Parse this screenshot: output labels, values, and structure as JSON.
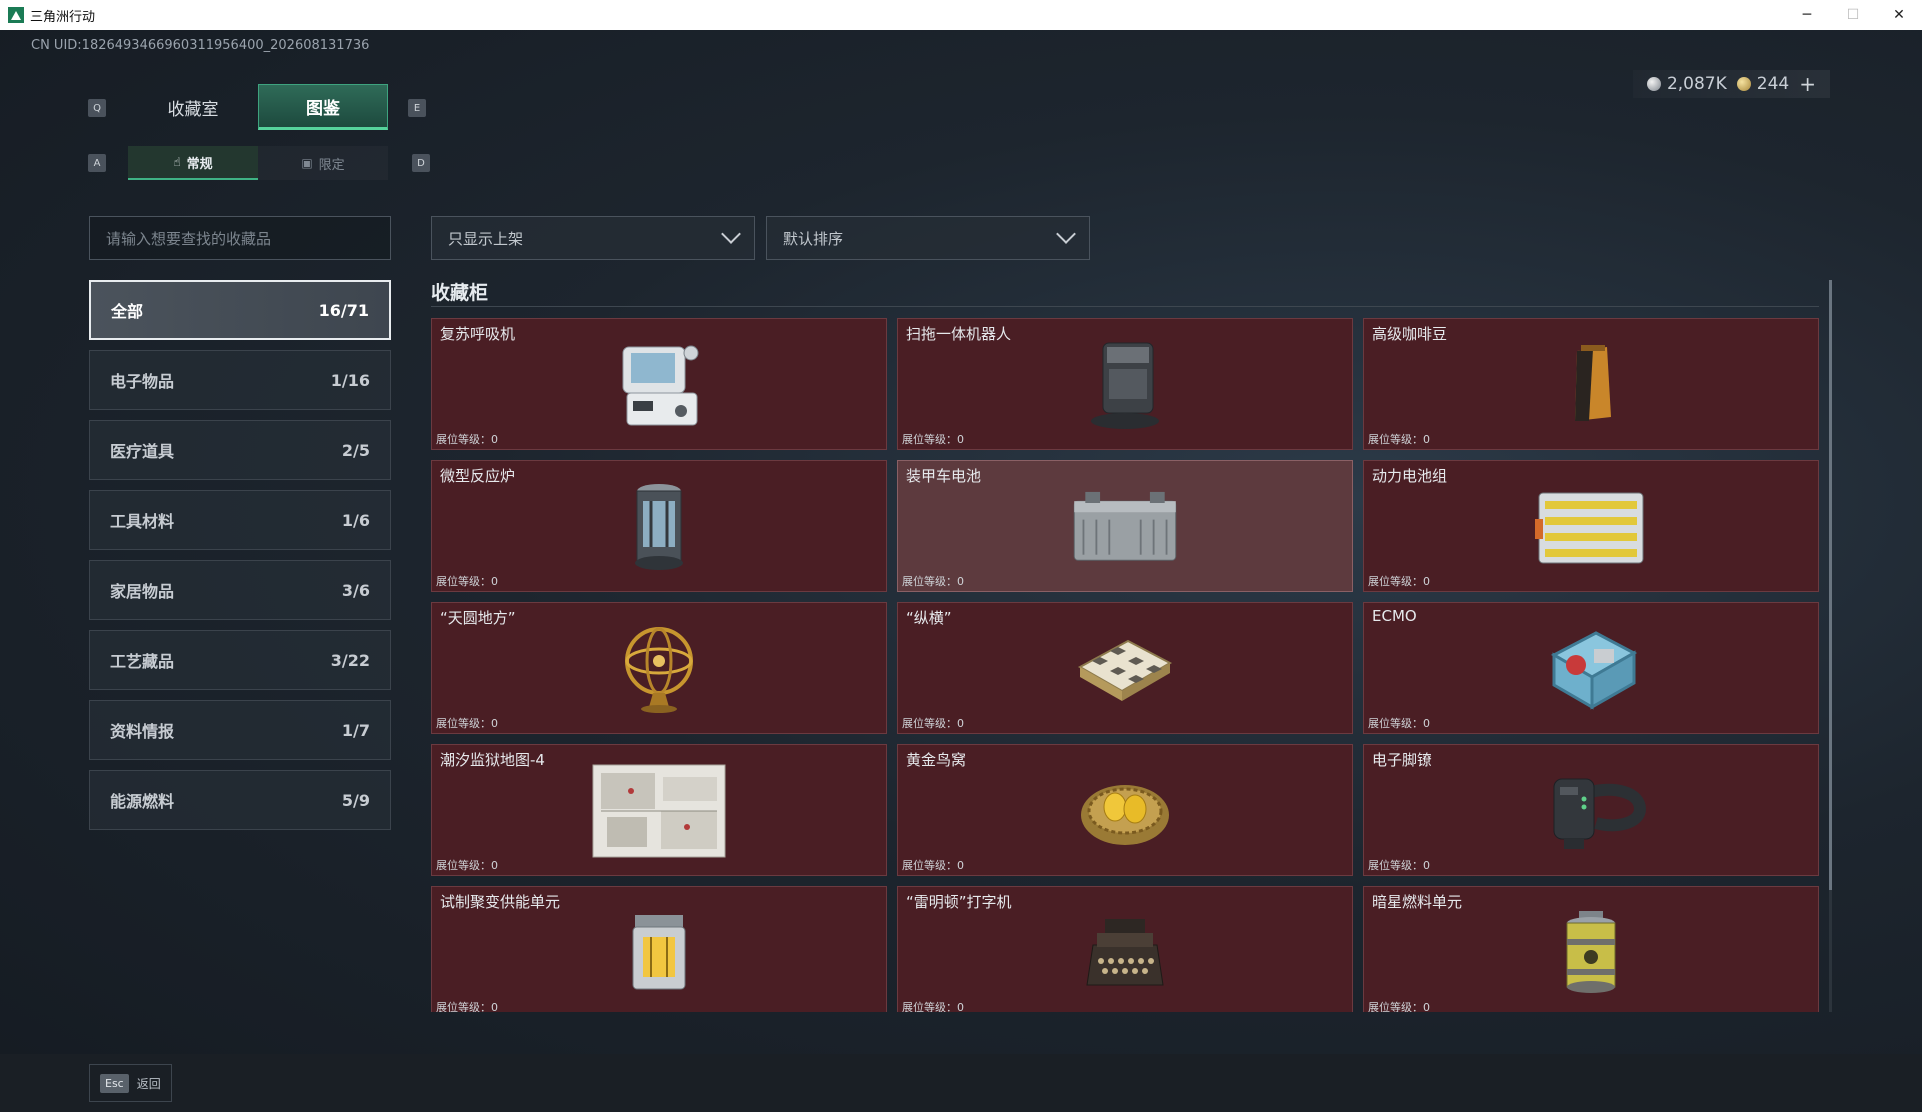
{
  "window": {
    "title": "三角洲行动",
    "controls": {
      "minimize": "─",
      "maximize": "☐",
      "close": "✕"
    }
  },
  "uid": "CN UID:1826493466960311956400_202608131736",
  "currency": {
    "silver": "2,087K",
    "gold": "244",
    "add": "+"
  },
  "keys": {
    "prev_tab": "Q",
    "next_tab": "E",
    "prev_sub": "A",
    "next_sub": "D"
  },
  "main_tabs": [
    {
      "label": "收藏室",
      "active": false
    },
    {
      "label": "图鉴",
      "active": true
    }
  ],
  "sub_tabs": [
    {
      "label": "常规",
      "icon": "hand-icon",
      "active": true
    },
    {
      "label": "限定",
      "icon": "image-icon",
      "active": false
    }
  ],
  "search": {
    "placeholder": "请输入想要查找的收藏品"
  },
  "categories": [
    {
      "label": "全部",
      "count": "16/71",
      "active": true
    },
    {
      "label": "电子物品",
      "count": "1/16"
    },
    {
      "label": "医疗道具",
      "count": "2/5"
    },
    {
      "label": "工具材料",
      "count": "1/6"
    },
    {
      "label": "家居物品",
      "count": "3/6"
    },
    {
      "label": "工艺藏品",
      "count": "3/22"
    },
    {
      "label": "资料情报",
      "count": "1/7"
    },
    {
      "label": "能源燃料",
      "count": "5/9"
    }
  ],
  "filters": {
    "display": "只显示上架",
    "sort": "默认排序"
  },
  "section_title": "收藏柜",
  "items": [
    {
      "name": "复苏呼吸机",
      "level": "展位等级：0",
      "icon": "ventilator-icon"
    },
    {
      "name": "扫拖一体机器人",
      "level": "展位等级：0",
      "icon": "robot-vacuum-icon"
    },
    {
      "name": "高级咖啡豆",
      "level": "展位等级：0",
      "icon": "coffee-bag-icon"
    },
    {
      "name": "微型反应炉",
      "level": "展位等级：0",
      "icon": "reactor-icon"
    },
    {
      "name": "装甲车电池",
      "level": "展位等级：0",
      "icon": "vehicle-battery-icon"
    },
    {
      "name": "动力电池组",
      "level": "展位等级：0",
      "icon": "battery-pack-icon"
    },
    {
      "name": "“天圆地方”",
      "level": "展位等级：0",
      "icon": "armillary-sphere-icon"
    },
    {
      "name": "“纵横”",
      "level": "展位等级：0",
      "icon": "chessboard-icon"
    },
    {
      "name": "ECMO",
      "level": "展位等级：0",
      "icon": "ecmo-machine-icon"
    },
    {
      "name": "潮汐监狱地图-4",
      "level": "展位等级：0",
      "icon": "map-icon"
    },
    {
      "name": "黄金鸟窝",
      "level": "展位等级：0",
      "icon": "golden-nest-icon"
    },
    {
      "name": "电子脚镣",
      "level": "展位等级：0",
      "icon": "ankle-monitor-icon"
    },
    {
      "name": "试制聚变供能单元",
      "level": "展位等级：0",
      "icon": "fusion-unit-icon"
    },
    {
      "name": "“雷明顿”打字机",
      "level": "展位等级：0",
      "icon": "typewriter-icon"
    },
    {
      "name": "暗星燃料单元",
      "level": "展位等级：0",
      "icon": "fuel-canister-icon"
    }
  ],
  "bottom": {
    "esc_key": "Esc",
    "back_label": "返回"
  }
}
